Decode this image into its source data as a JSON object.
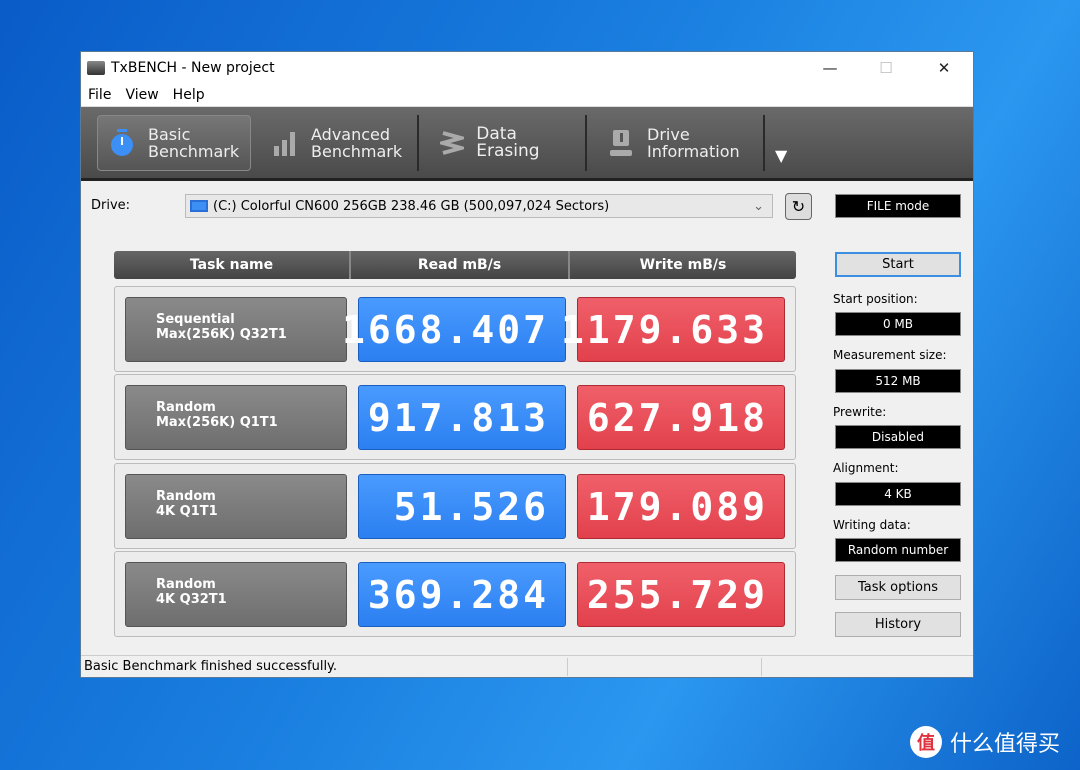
{
  "window": {
    "title": "TxBENCH - New project",
    "minimize": "—",
    "maximize": "☐",
    "close": "✕"
  },
  "menu": [
    "File",
    "View",
    "Help"
  ],
  "toolbar": [
    {
      "line1": "Basic",
      "line2": "Benchmark",
      "icon": "stopwatch-icon"
    },
    {
      "line1": "Advanced",
      "line2": "Benchmark",
      "icon": "bar-chart-icon"
    },
    {
      "line1": "Data Erasing",
      "line2": "",
      "icon": "eraser-icon"
    },
    {
      "line1": "Drive",
      "line2": "Information",
      "icon": "drive-info-icon"
    }
  ],
  "toolbar_more": "▼",
  "drive": {
    "label": "Drive:",
    "value": "(C:) Colorful CN600 256GB  238.46 GB (500,097,024 Sectors)"
  },
  "mode": "FILE mode",
  "start": "Start",
  "settings": [
    {
      "label": "Start position:",
      "value": "0 MB"
    },
    {
      "label": "Measurement size:",
      "value": "512 MB"
    },
    {
      "label": "Prewrite:",
      "value": "Disabled"
    },
    {
      "label": "Alignment:",
      "value": "4 KB"
    },
    {
      "label": "Writing data:",
      "value": "Random number"
    }
  ],
  "task_options": "Task options",
  "history": "History",
  "table": {
    "headers": [
      "Task name",
      "Read mB/s",
      "Write mB/s"
    ],
    "rows": [
      {
        "l1": "Sequential",
        "l2": "Max(256K) Q32T1",
        "read": "1668.407",
        "write": "1179.633"
      },
      {
        "l1": "Random",
        "l2": "Max(256K) Q1T1",
        "read": "917.813",
        "write": "627.918"
      },
      {
        "l1": "Random",
        "l2": "4K Q1T1",
        "read": "51.526",
        "write": "179.089"
      },
      {
        "l1": "Random",
        "l2": "4K Q32T1",
        "read": "369.284",
        "write": "255.729"
      }
    ]
  },
  "status": "Basic Benchmark finished successfully.",
  "watermark": {
    "logo": "值",
    "text": "什么值得买"
  },
  "colors": {
    "read": "#2b7ff0",
    "write": "#e2414c"
  }
}
